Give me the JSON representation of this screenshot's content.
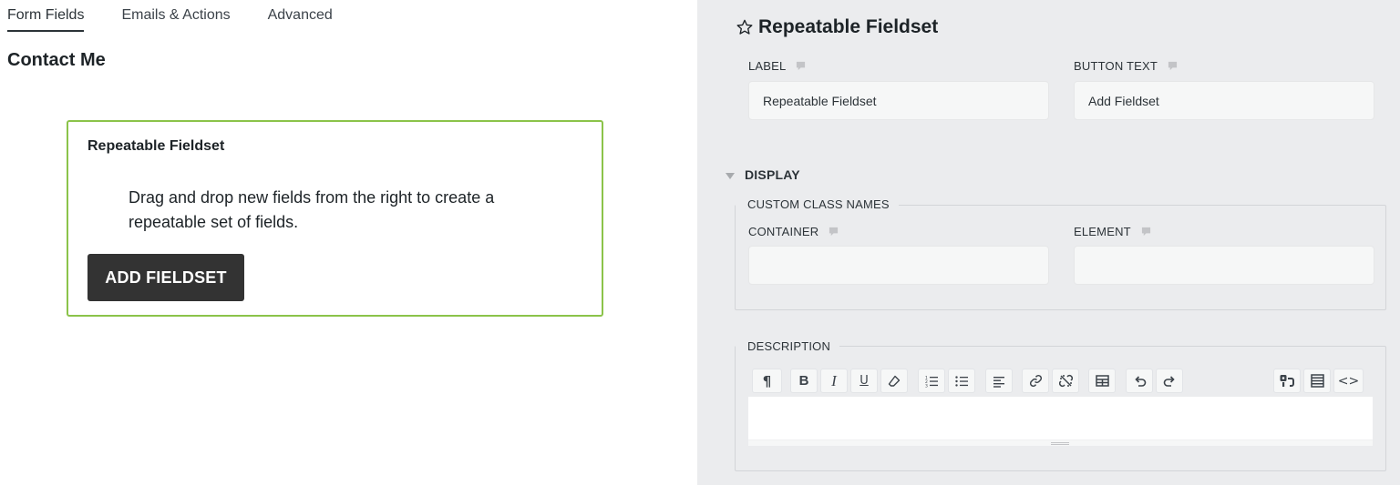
{
  "tabs": [
    {
      "label": "Form Fields",
      "active": true
    },
    {
      "label": "Emails & Actions",
      "active": false
    },
    {
      "label": "Advanced",
      "active": false
    }
  ],
  "form": {
    "title": "Contact Me",
    "fieldset": {
      "title": "Repeatable Fieldset",
      "description": "Drag and drop new fields from the right to create a repeatable set of fields.",
      "button_label": "ADD FIELDSET"
    }
  },
  "panel": {
    "title": "Repeatable Fieldset",
    "title_icon": "star-outline-icon",
    "label": {
      "label": "LABEL",
      "value": "Repeatable Fieldset"
    },
    "button_text": {
      "label": "BUTTON TEXT",
      "value": "Add Fieldset"
    },
    "display": {
      "label": "DISPLAY",
      "custom_class_names": {
        "legend": "CUSTOM CLASS NAMES",
        "container": {
          "label": "CONTAINER",
          "value": ""
        },
        "element": {
          "label": "ELEMENT",
          "value": ""
        }
      }
    },
    "description": {
      "legend": "DESCRIPTION",
      "toolbar_left": [
        "paragraph-icon",
        "bold-icon",
        "italic-icon",
        "underline-icon",
        "eraser-icon",
        "ordered-list-icon",
        "bullet-list-icon",
        "align-left-icon",
        "link-icon",
        "unlink-icon",
        "table-icon",
        "undo-icon",
        "redo-icon"
      ],
      "toolbar_right": [
        "merge-tags-icon",
        "form-layout-icon",
        "code-view-icon"
      ],
      "content": ""
    }
  },
  "colors": {
    "accent_border": "#8bc34a",
    "button_bg": "#333333",
    "panel_bg": "#ebecee"
  }
}
